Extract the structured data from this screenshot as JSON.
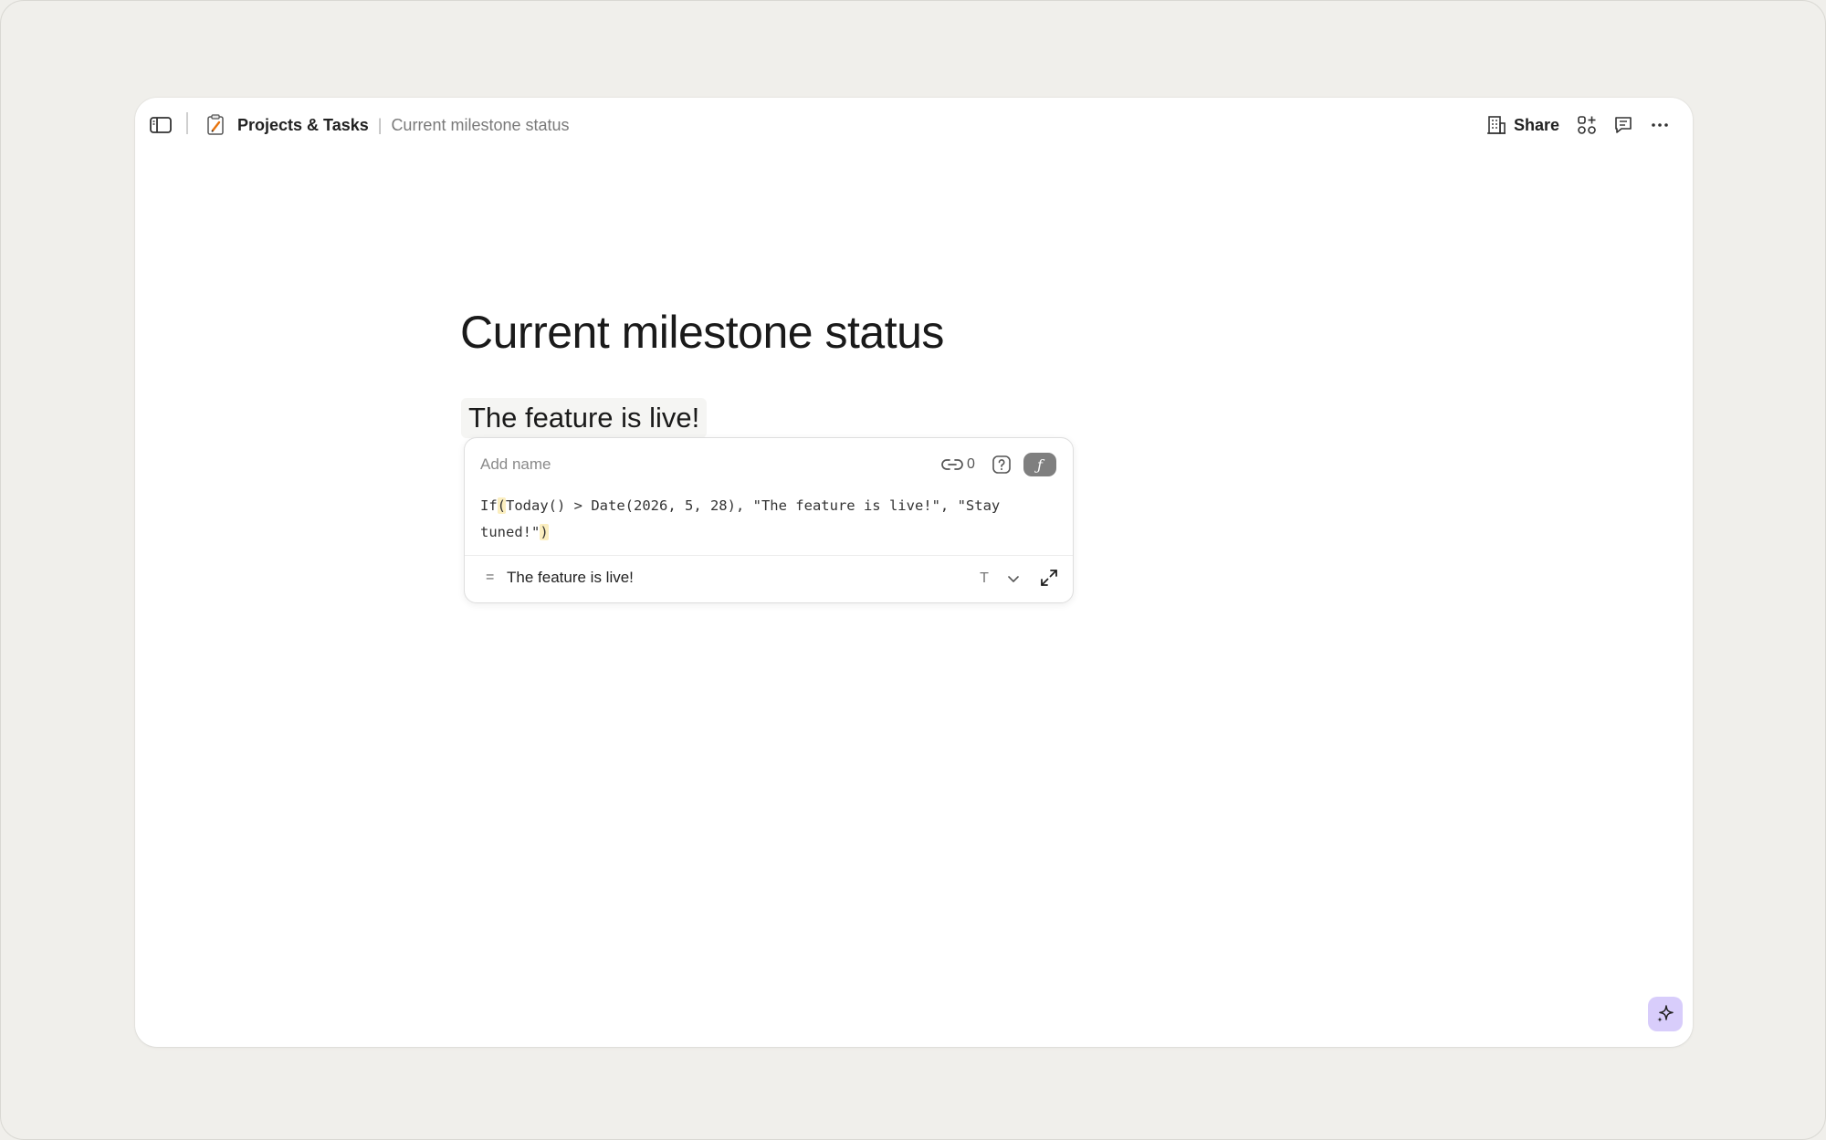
{
  "topbar": {
    "doc_name": "Projects & Tasks",
    "separator": "|",
    "page_name": "Current milestone status",
    "share_label": "Share"
  },
  "page": {
    "title": "Current milestone status",
    "formula_result_display": "The feature is live!"
  },
  "formula_editor": {
    "name_placeholder": "Add name",
    "name_value": "",
    "reference_count": "0",
    "fx_label": "ƒ",
    "code_prefix": "If",
    "code_open_paren": "(",
    "code_body": "Today() > Date(2026, 5, 28), \"The feature is live!\", \"Stay tuned!\"",
    "code_close_paren": ")",
    "equals_sign": "=",
    "result_value": "The feature is live!",
    "result_type_label": "T"
  },
  "colors": {
    "background": "#f0efeb",
    "window": "#ffffff",
    "fx_button": "#7f7f7f",
    "paren_highlight": "#fbeebf",
    "ai_button": "#d8cdfb"
  },
  "icons": {
    "sidebar_toggle": "sidebar-panel-icon",
    "doc": "notepad-pencil-icon",
    "share": "building-icon",
    "apps": "apps-plus-icon",
    "comments": "comment-icon",
    "more": "ellipsis-icon",
    "link": "link-icon",
    "help": "question-icon",
    "dropdown": "chevron-down-icon",
    "expand": "expand-icon",
    "ai": "sparkle-icon"
  }
}
